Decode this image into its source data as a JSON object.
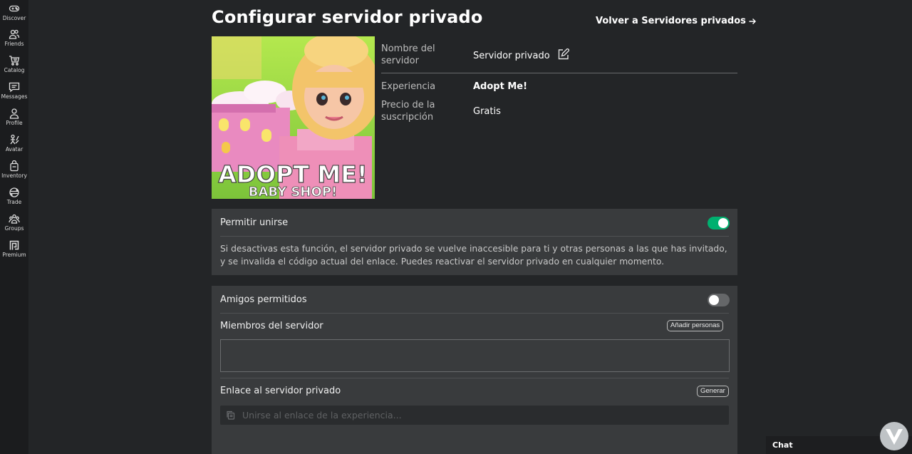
{
  "nav": {
    "items": [
      {
        "label": "Discover",
        "icon": "gamepad-icon"
      },
      {
        "label": "Friends",
        "icon": "friends-icon"
      },
      {
        "label": "Catalog",
        "icon": "cart-icon"
      },
      {
        "label": "Messages",
        "icon": "message-icon"
      },
      {
        "label": "Profile",
        "icon": "profile-icon"
      },
      {
        "label": "Avatar",
        "icon": "avatar-icon"
      },
      {
        "label": "Inventory",
        "icon": "inventory-icon"
      },
      {
        "label": "Trade",
        "icon": "trade-icon"
      },
      {
        "label": "Groups",
        "icon": "groups-icon"
      },
      {
        "label": "Premium",
        "icon": "premium-icon"
      }
    ]
  },
  "header": {
    "title": "Configurar servidor privado",
    "back_link": "Volver a Servidores privados"
  },
  "thumbnail": {
    "title_line1": "ADOPT ME!",
    "title_line2": "BABY SHOP!"
  },
  "info": {
    "name_label": "Nombre del servidor",
    "name_value": "Servidor privado",
    "experience_label": "Experiencia",
    "experience_value": "Adopt Me!",
    "price_label": "Precio de la suscripción",
    "price_value": "Gratis"
  },
  "allow_join": {
    "title": "Permitir unirse",
    "enabled": true,
    "description": "Si desactivas esta función, el servidor privado se vuelve inaccesible para ti y otras personas a las que has invitado, y se invalida el código actual del enlace. Puedes reactivar el servidor privado en cualquier momento."
  },
  "settings": {
    "friends_allowed_label": "Amigos permitidos",
    "friends_allowed": false,
    "members_label": "Miembros del servidor",
    "add_people_button": "Añadir personas",
    "link_label": "Enlace al servidor privado",
    "generate_button": "Generar",
    "link_placeholder": "Unirse al enlace de la experiencia..."
  },
  "chat": {
    "label": "Chat"
  },
  "colors": {
    "background": "#232527",
    "panel": "#393b3d",
    "toggle_on": "#00b06f",
    "toggle_off": "#656769"
  }
}
